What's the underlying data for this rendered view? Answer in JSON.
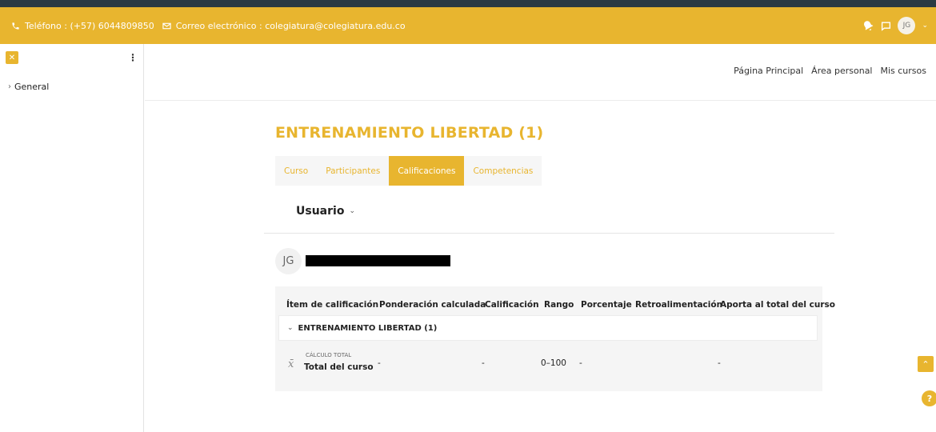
{
  "topbar": {
    "phone_label": "Teléfono : (+57) 6044809850",
    "email_label": "Correo electrónico : colegiatura@colegiatura.edu.co",
    "avatar_initials": "JG",
    "accent_color": "#e8b52f"
  },
  "sidebar": {
    "close_icon": "close-icon",
    "section": "General"
  },
  "nav": {
    "items": [
      "Página Principal",
      "Área personal",
      "Mis cursos"
    ]
  },
  "course": {
    "title": "ENTRENAMIENTO LIBERTAD (1)",
    "tabs": [
      {
        "label": "Curso",
        "active": false
      },
      {
        "label": "Participantes",
        "active": false
      },
      {
        "label": "Calificaciones",
        "active": true
      },
      {
        "label": "Competencias",
        "active": false
      }
    ]
  },
  "user_selector": {
    "label": "Usuario"
  },
  "user": {
    "initials": "JG"
  },
  "grades": {
    "headers": [
      "Ítem de calificación",
      "Ponderación calculada",
      "Calificación",
      "Rango",
      "Porcentaje",
      "Retroalimentación",
      "Aporta al total del curso"
    ],
    "category": "ENTRENAMIENTO LIBERTAD (1)",
    "total": {
      "sub_label": "CÁLCULO TOTAL",
      "name": "Total del curso",
      "weight": "-",
      "grade": "-",
      "range": "0–100",
      "percentage": "-",
      "contribution": "-"
    }
  }
}
